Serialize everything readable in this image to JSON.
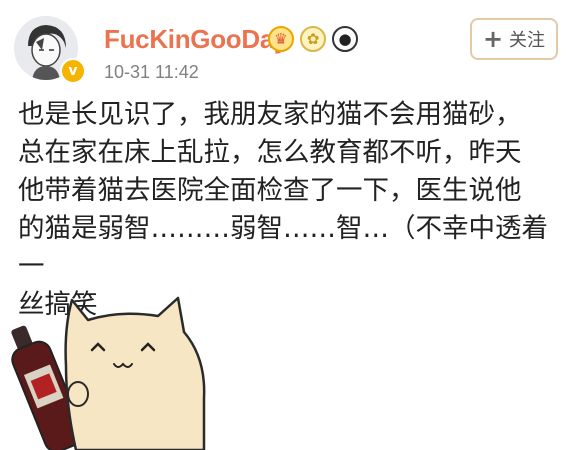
{
  "user": {
    "name": "FucKinGooDay",
    "verified_mark": "v",
    "badges": [
      {
        "icon": "crown-badge-icon",
        "glyph": "♛"
      },
      {
        "icon": "lotus-badge-icon",
        "glyph": "✿"
      },
      {
        "icon": "panda-badge-icon",
        "glyph": "●"
      }
    ]
  },
  "post": {
    "timestamp": "10-31 11:42",
    "lines": [
      "也是长见识了，我朋友家的猫不会用猫砂，",
      "总在家在床上乱拉，怎么教育都不听，昨天",
      "他带着猫去医院全面检查了一下，医生说他",
      "的猫是弱智………弱智……智…（不幸中透着一",
      "丝搞笑"
    ]
  },
  "follow_button": {
    "icon": "plus-icon",
    "glyph": "+",
    "label": "关注"
  },
  "colors": {
    "username": "#eb7350",
    "timestamp": "#808080",
    "text": "#222222",
    "follow_border": "#e5c8a8"
  }
}
